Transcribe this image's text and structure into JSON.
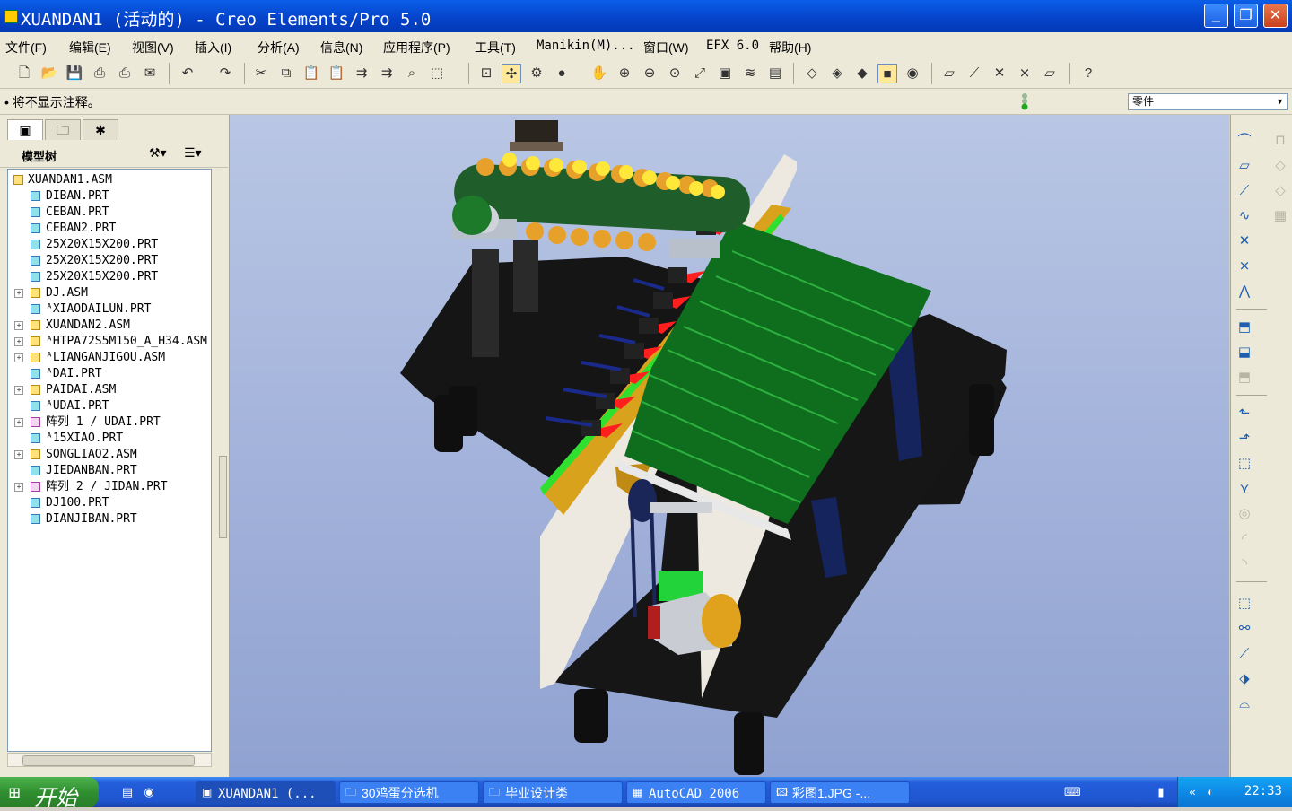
{
  "window": {
    "title": "XUANDAN1 (活动的) - Creo Elements/Pro 5.0",
    "controls": {
      "minimize": "_",
      "maximize": "❐",
      "close": "✕"
    }
  },
  "menu": [
    "文件(F)",
    "编辑(E)",
    "视图(V)",
    "插入(I)",
    "分析(A)",
    "信息(N)",
    "应用程序(P)",
    "工具(T)",
    "Manikin(M)...",
    "窗口(W)",
    "EFX 6.0",
    "帮助(H)"
  ],
  "message": "• 将不显示注释。",
  "filter": {
    "value": "零件"
  },
  "navigator": {
    "tree_title": "模型树",
    "tree": [
      {
        "label": "XUANDAN1.ASM",
        "type": "asm",
        "expandable": false,
        "root": true
      },
      {
        "label": "DIBAN.PRT",
        "type": "prt",
        "expandable": false
      },
      {
        "label": "CEBAN.PRT",
        "type": "prt",
        "expandable": false
      },
      {
        "label": "CEBAN2.PRT",
        "type": "prt",
        "expandable": false
      },
      {
        "label": "25X20X15X200.PRT",
        "type": "prt",
        "expandable": false
      },
      {
        "label": "25X20X15X200.PRT",
        "type": "prt",
        "expandable": false
      },
      {
        "label": "25X20X15X200.PRT",
        "type": "prt",
        "expandable": false
      },
      {
        "label": "DJ.ASM",
        "type": "asm",
        "expandable": true
      },
      {
        "label": "ᴬXIAODAILUN.PRT",
        "type": "prt",
        "expandable": false
      },
      {
        "label": "XUANDAN2.ASM",
        "type": "asm",
        "expandable": true
      },
      {
        "label": "ᴬHTPA72S5M150_A_H34.ASM",
        "type": "asm",
        "expandable": true
      },
      {
        "label": "ᴬLIANGANJIGOU.ASM",
        "type": "asm",
        "expandable": true
      },
      {
        "label": "ᴬDAI.PRT",
        "type": "prt",
        "expandable": false
      },
      {
        "label": "PAIDAI.ASM",
        "type": "asm",
        "expandable": true
      },
      {
        "label": "ᴬUDAI.PRT",
        "type": "prt",
        "expandable": false
      },
      {
        "label": "阵列 1 / UDAI.PRT",
        "type": "pat",
        "expandable": true
      },
      {
        "label": "ᴬ15XIAO.PRT",
        "type": "prt",
        "expandable": false
      },
      {
        "label": "SONGLIAO2.ASM",
        "type": "asm",
        "expandable": true
      },
      {
        "label": "JIEDANBAN.PRT",
        "type": "prt",
        "expandable": false
      },
      {
        "label": "阵列 2 / JIDAN.PRT",
        "type": "pat",
        "expandable": true
      },
      {
        "label": "DJ100.PRT",
        "type": "prt",
        "expandable": false
      },
      {
        "label": "DIANJIBAN.PRT",
        "type": "prt",
        "expandable": false
      }
    ]
  },
  "taskbar": {
    "start": "开始",
    "tasks": [
      {
        "label": "XUANDAN1 (...",
        "icon": "creo-icon"
      },
      {
        "label": "30鸡蛋分选机",
        "icon": "folder-icon"
      },
      {
        "label": "毕业设计类",
        "icon": "folder-icon"
      },
      {
        "label": "AutoCAD 2006",
        "icon": "autocad-icon"
      },
      {
        "label": "彩图1.JPG -...",
        "icon": "image-icon"
      }
    ],
    "clock": "22:33"
  },
  "colors": {
    "titlebar": "#0a5ee8",
    "taskbar": "#245edb",
    "start": "#2f8f2f",
    "graphics_bg": "#a6b5dc"
  }
}
